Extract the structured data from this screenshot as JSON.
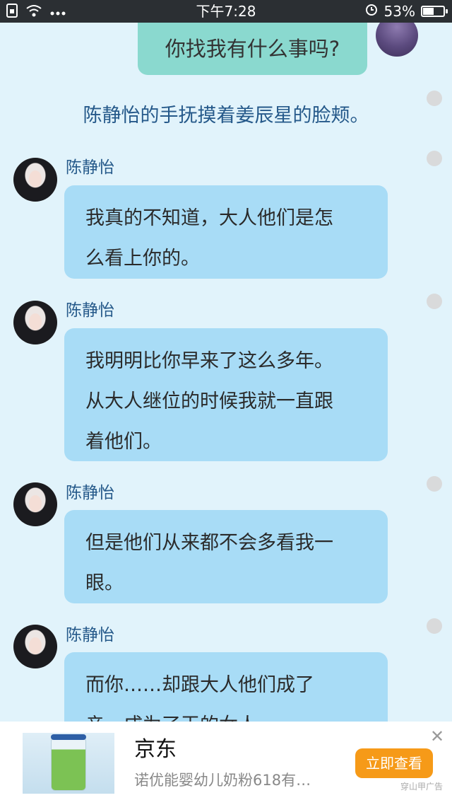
{
  "status_bar": {
    "time": "下午7:28",
    "battery_percent": "53%",
    "battery_level": 0.53,
    "left_icons": [
      "sim-icon",
      "wifi-icon",
      "more-icon"
    ],
    "right_icons": [
      "alarm-icon",
      "battery-icon"
    ]
  },
  "chat": {
    "my_message": "你找我有什么事吗?",
    "narration": "陈静怡的手抚摸着姜辰星的脸颊。",
    "messages": [
      {
        "speaker": "陈静怡",
        "lines": [
          "我真的不知道，大人他们是怎",
          "么看上你的。"
        ]
      },
      {
        "speaker": "陈静怡",
        "lines": [
          "我明明比你早来了这么多年。",
          "从大人继位的时候我就一直跟",
          "着他们。"
        ]
      },
      {
        "speaker": "陈静怡",
        "lines": [
          "但是他们从来都不会多看我一",
          "眼。"
        ]
      },
      {
        "speaker": "陈静怡",
        "lines": [
          "而你……却跟大人他们成了",
          "亲，成为了王的女人。"
        ]
      }
    ]
  },
  "ad": {
    "title": "京东",
    "description": "诺优能婴幼儿奶粉618有…",
    "button_label": "立即查看",
    "close_symbol": "✕",
    "label": "穿山甲广告",
    "button_color": "#f69a18"
  }
}
